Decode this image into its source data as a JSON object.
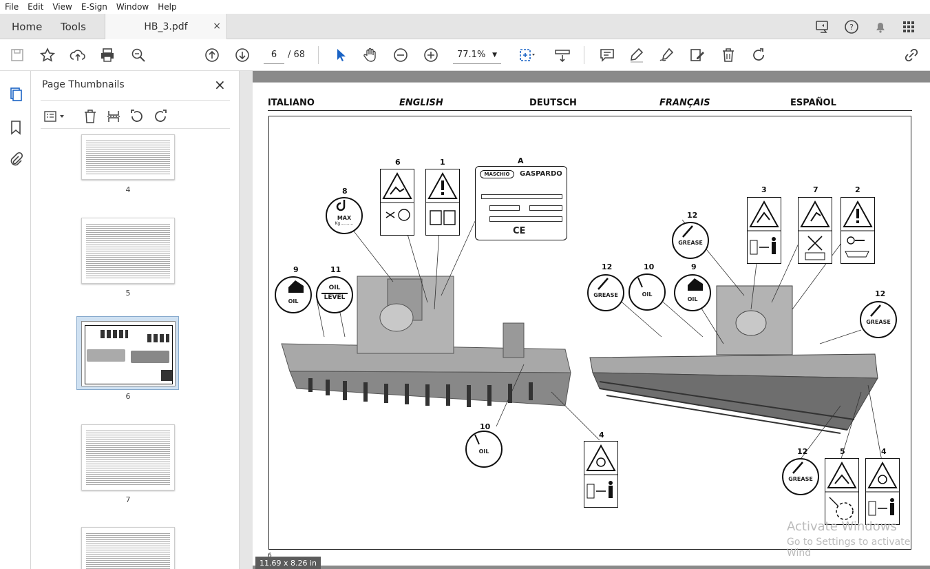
{
  "menu": [
    "File",
    "Edit",
    "View",
    "E-Sign",
    "Window",
    "Help"
  ],
  "tabs": {
    "home": "Home",
    "tools": "Tools",
    "document": "HB_3.pdf",
    "close": "×"
  },
  "toolbar": {
    "page_current": "6",
    "page_total": "/ 68",
    "zoom": "77.1%"
  },
  "thumbnails": {
    "title": "Page Thumbnails",
    "close": "×",
    "pages": [
      "4",
      "5",
      "6",
      "7"
    ],
    "selected": "6"
  },
  "document": {
    "languages": [
      "ITALIANO",
      "ENGLISH",
      "DEUTSCH",
      "FRANÇAIS",
      "ESPAÑOL"
    ],
    "callouts": [
      "6",
      "1",
      "A",
      "8",
      "3",
      "7",
      "2",
      "12",
      "9",
      "11",
      "12",
      "10",
      "9",
      "12",
      "10",
      "4",
      "12",
      "5",
      "4"
    ],
    "labels": {
      "max": "MAX",
      "kg": "Kg..........",
      "oil": "OIL",
      "oil_level_1": "OIL",
      "oil_level_2": "LEVEL",
      "grease": "GREASE"
    },
    "plate": {
      "brand": "MASCHIO",
      "brand2": "GASPARDO"
    },
    "page_size": "11.69 x 8.26 in",
    "page_number_small": "6"
  },
  "watermark": {
    "line1": "Activate Windows",
    "line2": "Go to Settings to activate Wind"
  }
}
